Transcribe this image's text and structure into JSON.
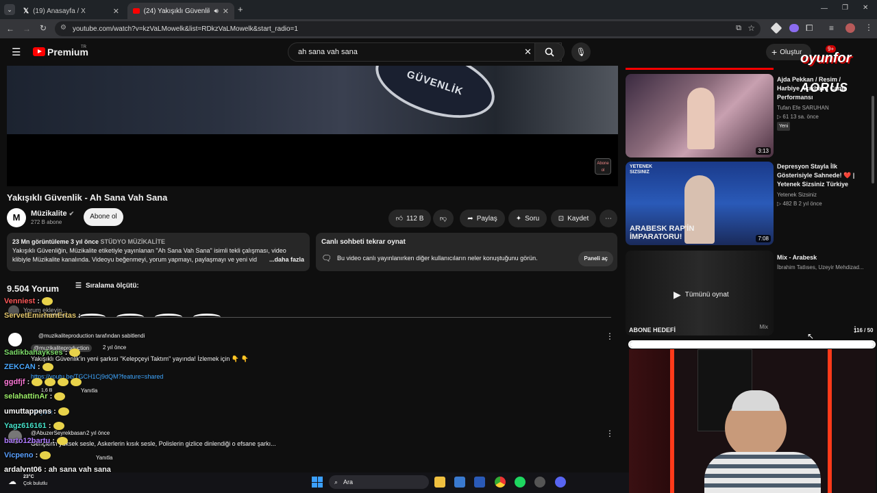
{
  "browser": {
    "tabs": [
      {
        "label": "(19) Anasayfa / X"
      },
      {
        "label": "(24) Yakışıklı Güvenlik - Ah"
      }
    ],
    "url": "youtube.com/watch?v=kzVaLMowelk&list=RDkzVaLMowelk&start_radio=1"
  },
  "youtube": {
    "logo_text": "Premium",
    "logo_region": "TR",
    "search_value": "ah sana vah sana",
    "create_label": "Oluştur",
    "notif_count": "9+",
    "video": {
      "title": "Yakışıklı Güvenlik - Ah Sana Vah Sana",
      "patch_text": "GÜVENLİK",
      "abone_badge": "Abone ol",
      "channel": "Müzikalite",
      "subs": "272 B abone",
      "subscribe_label": "Abone ol",
      "likes": "112 B",
      "share": "Paylaş",
      "ask": "Soru",
      "save": "Kaydet"
    },
    "description": {
      "meta": "23 Mn görüntüleme  3 yıl önce",
      "tag": "STÜDYO MÜZİKALİTE",
      "text": "Yakışıklı Güvenliğin, Müzikalite etiketiyle yayınlanan \"Ah Sana Vah Sana\" isimli tekli çalışması, video klibiyle Müzikalite kanalında. Videoyu beğenmeyi, yorum yapmayı, paylaşmayı ve yeni vid",
      "more": "...daha fazla"
    },
    "chat_replay": {
      "title": "Canlı sohbeti tekrar oynat",
      "text": "Bu video canlı yayınlanırken diğer kullanıcıların neler konuştuğunu görün.",
      "button": "Paneli aç"
    },
    "comments": {
      "count": "9.504 Yorum",
      "sort": "Sıralama ölçütü:",
      "add_placeholder": "Yorum ekleyin...",
      "pinned": "@muzikaliteproduction tarafından sabitlendi",
      "c1_author": "@muzikaliteproduction",
      "c1_time": "2 yıl önce",
      "c1_text": "Yakışıklı Güvenlik'in yeni şarkısı \"Kelepçeyi Taktım\" yayında! İzlemek için 👇 👇",
      "c1_link": "https://youtu.be/TGCH1Cj9dQM?feature=shared",
      "c1_likes": "1,6 B",
      "c1_reply": "Yanıtla",
      "c1_replies": "25 yanıt",
      "c2_author": "@AbuzerSeyrekbasan",
      "c2_time": "2 yıl önce",
      "c2_text": "Gençlerin yüksek sesle, Askerlerin kısık sesle, Polislerin gizlice dinlendiği o efsane şarkı...",
      "c2_reply": "Yanıtla"
    }
  },
  "sidebar": {
    "items": [
      {
        "title": "Ajda Pekkan / Resim / Harbiye Açıkhava Canlı Performansı",
        "channel": "Tufan Efe SARUHAN",
        "meta": "▷ 61  13 sa. önce",
        "badge": "Yeni",
        "duration": "3:13"
      },
      {
        "title": "Depresyon Stayla İlk Gösterisiyle Sahnede! ❤️ | Yetenek Sizsiniz Türkiye",
        "channel": "Yetenek Sizsiniz",
        "meta": "▷ 482 B  2 yıl önce",
        "thumb_top": "YETENEK SIZSINIZ",
        "thumb_caption": "ARABESK RAP'İN İMPARATORU!",
        "duration": "7:08"
      },
      {
        "title": "Mix - Arabesk",
        "channel": "İbrahim Tatlıses, Uzeyir Mehdizad...",
        "play_all": "Tümünü oynat",
        "mix_badge": "Mix"
      }
    ]
  },
  "overlay": {
    "brand": "oyunfor",
    "brand2": "AORUS",
    "goal_label": "ABONE HEDEFİ",
    "goal_count": "116 / 50",
    "goal_progress": 1.0,
    "chat": [
      {
        "user": "Venniest",
        "color": "#ff5a5a",
        "msg": ":"
      },
      {
        "user": "ServetEmirhanErtas",
        "color": "#e0c46c",
        "msg": ":"
      },
      {
        "user": "Sadikbahaykses",
        "color": "#7ddc6a",
        "msg": ":"
      },
      {
        "user": "ZEKCAN",
        "color": "#4aa8ff",
        "msg": ":"
      },
      {
        "user": "ggdfjf",
        "color": "#ff7ad9",
        "msg": ":"
      },
      {
        "user": "selahattinAr",
        "color": "#9ef06a",
        "msg": ":"
      },
      {
        "user": "umuttappens",
        "color": "#ffffff",
        "msg": ":"
      },
      {
        "user": "Yagz616161",
        "color": "#46e0c8",
        "msg": ":"
      },
      {
        "user": "barto12bartu",
        "color": "#b07cff",
        "msg": ":"
      },
      {
        "user": "Vicpeno",
        "color": "#5aa0ff",
        "msg": ":"
      },
      {
        "user": "ardalvnt06",
        "color": "#ffffff",
        "msg": ": ah sana vah sana"
      }
    ]
  },
  "taskbar": {
    "weather_temp": "23°C",
    "weather_text": "Çok bulutlu",
    "search_label": "Ara"
  }
}
